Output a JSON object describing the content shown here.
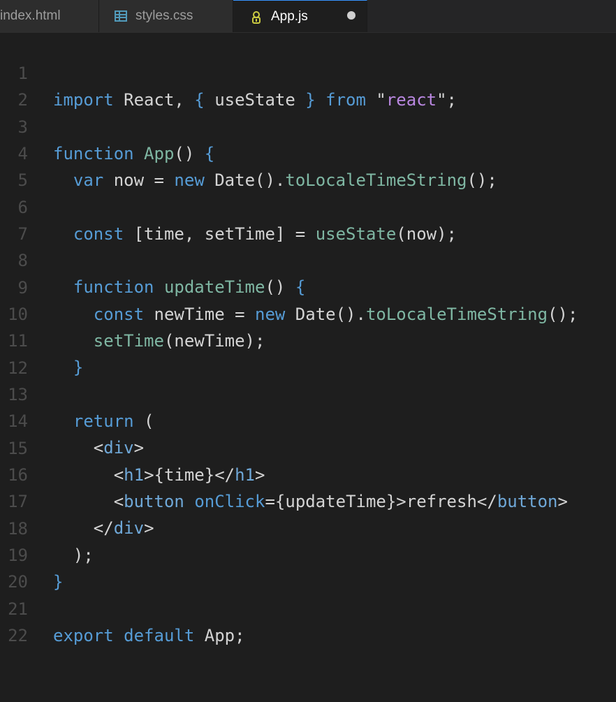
{
  "tabs": [
    {
      "label": "index.html"
    },
    {
      "label": "styles.css",
      "icon": "css-file-icon"
    },
    {
      "label": "App.js",
      "icon": "js-file-icon",
      "active": true,
      "unsaved": true
    }
  ],
  "code": {
    "line_numbers": [
      "1",
      "2",
      "3",
      "4",
      "5",
      "6",
      "7",
      "8",
      "9",
      "10",
      "11",
      "12",
      "13",
      "14",
      "15",
      "16",
      "17",
      "18",
      "19",
      "20",
      "21",
      "22"
    ],
    "lines": [
      "import React, { useState } from \"react\";",
      "",
      "function App() {",
      "  var now = new Date().toLocaleTimeString();",
      "",
      "  const [time, setTime] = useState(now);",
      "",
      "  function updateTime() {",
      "    const newTime = new Date().toLocaleTimeString();",
      "    setTime(newTime);",
      "  }",
      "",
      "  return (",
      "    <div>",
      "      <h1>{time}</h1>",
      "      <button onClick={updateTime}>refresh</button>",
      "    </div>",
      "  );",
      "}",
      "",
      "export default App;",
      ""
    ]
  }
}
